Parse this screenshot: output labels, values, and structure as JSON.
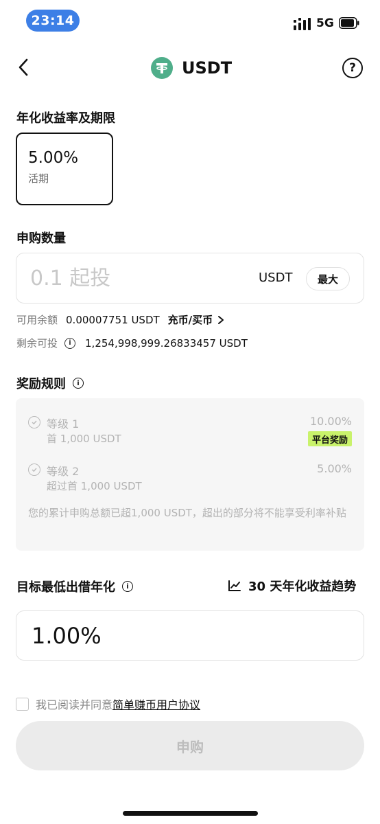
{
  "status_bar": {
    "time": "23:14",
    "network": "5G"
  },
  "header": {
    "title": "USDT",
    "help_label": "?"
  },
  "rate_section": {
    "title": "年化收益率及期限",
    "option": {
      "rate": "5.00%",
      "term": "活期"
    }
  },
  "amount_section": {
    "title": "申购数量",
    "placeholder": "0.1 起投",
    "unit": "USDT",
    "max_label": "最大"
  },
  "balance": {
    "label": "可用余额",
    "value": "0.00007751 USDT",
    "link": "充币/买币"
  },
  "remaining": {
    "label": "剩余可投",
    "value": "1,254,998,999.26833457 USDT"
  },
  "rewards": {
    "title": "奖励规则",
    "tiers": [
      {
        "name": "等级 1",
        "desc": "首 1,000 USDT",
        "rate": "10.00%",
        "badge": "平台奖励"
      },
      {
        "name": "等级 2",
        "desc": "超过首 1,000 USDT",
        "rate": "5.00%"
      }
    ],
    "note": "您的累计申购总额已超1,000 USDT，超出的部分将不能享受利率补贴"
  },
  "target_section": {
    "title": "目标最低出借年化",
    "trend_link": "30 天年化收益趋势",
    "value": "1.00%"
  },
  "agreement": {
    "text": "我已阅读并同意",
    "link": "简单赚币用户协议"
  },
  "submit_label": "申购",
  "colors": {
    "time_pill": "#3d7fe6",
    "coin": "#4fae8a",
    "badge": "#c9f26b",
    "submit_bg": "#ebebeb"
  }
}
